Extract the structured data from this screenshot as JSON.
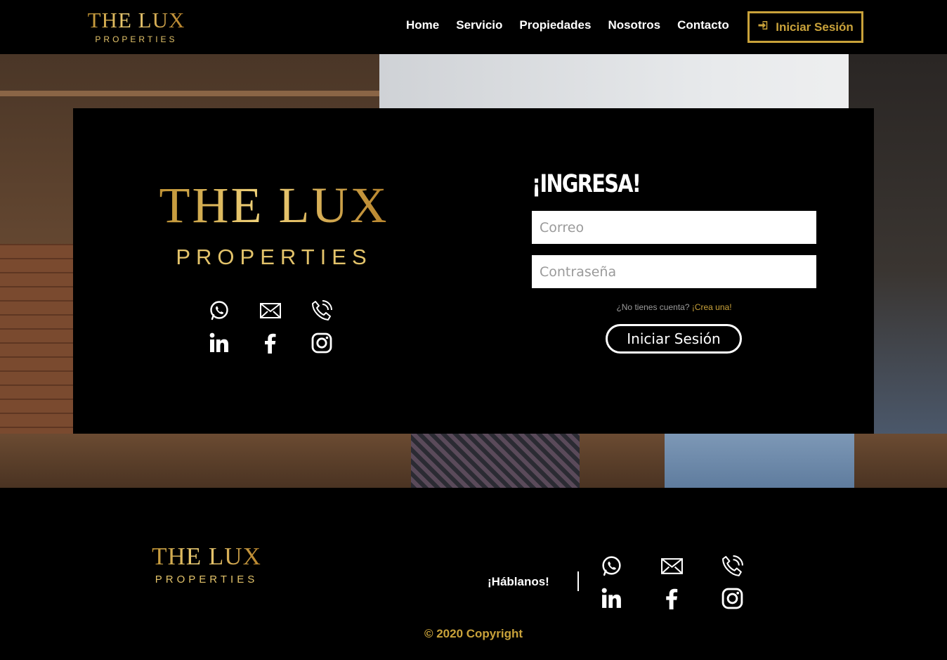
{
  "brand": {
    "name": "THE LUX",
    "tagline": "PROPERTIES"
  },
  "header": {
    "nav": [
      "Home",
      "Servicio",
      "Propiedades",
      "Nosotros",
      "Contacto"
    ],
    "login_label": "Iniciar Sesión",
    "login_icon": "sign-in-icon"
  },
  "login": {
    "title": "¡INGRESA!",
    "email_placeholder": "Correo",
    "password_placeholder": "Contraseña",
    "no_account": "¿No tienes cuenta?",
    "create_link": "¡Crea una!",
    "submit_label": "Iniciar Sesión"
  },
  "social_icons": [
    "whatsapp-icon",
    "mail-icon",
    "phone-icon",
    "linkedin-icon",
    "facebook-icon",
    "instagram-icon"
  ],
  "footer": {
    "talk_label": "¡Háblanos!",
    "copyright": "© 2020 Copyright"
  },
  "colors": {
    "gold": "#c9a23a",
    "background": "#000000",
    "text": "#ffffff"
  }
}
